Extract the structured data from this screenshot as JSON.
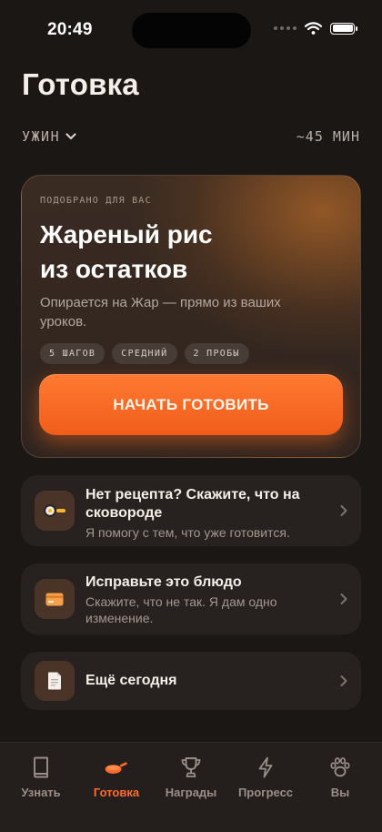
{
  "status_bar": {
    "time": "20:49"
  },
  "header": {
    "title": "Готовка",
    "meal": "УЖИН",
    "duration": "~45 МИН"
  },
  "hero": {
    "eyebrow": "ПОДОБРАНО ДЛЯ ВАС",
    "title_line1": "Жареный рис",
    "title_line2": "из остатков",
    "subtitle": "Опирается на Жар — прямо из ваших уроков.",
    "chips": [
      "5 ШАГОВ",
      "СРЕДНИЙ",
      "2 ПРОБЫ"
    ],
    "cta_label": "НАЧАТЬ ГОТОВИТЬ"
  },
  "actions": [
    {
      "title": "Нет рецепта? Скажите, что на сковороде",
      "desc": "Я помогу с тем, что уже готовится.",
      "icon": "pan-with-egg-icon"
    },
    {
      "title": "Исправьте это блюдо",
      "desc": "Скажите, что не так. Я дам одно изменение.",
      "icon": "card-icon"
    },
    {
      "title": "Ещё сегодня",
      "desc": "",
      "icon": "document-icon"
    }
  ],
  "tabs": [
    {
      "label": "Узнать",
      "icon": "book-icon",
      "active": false
    },
    {
      "label": "Готовка",
      "icon": "frying-pan-icon",
      "active": true
    },
    {
      "label": "Награды",
      "icon": "trophy-icon",
      "active": false
    },
    {
      "label": "Прогресс",
      "icon": "lightning-icon",
      "active": false
    },
    {
      "label": "Вы",
      "icon": "paw-icon",
      "active": false
    }
  ],
  "colors": {
    "background": "#1b1715",
    "accent": "#ff6b2a",
    "card": "#272220",
    "icon_box": "#4a3428"
  }
}
